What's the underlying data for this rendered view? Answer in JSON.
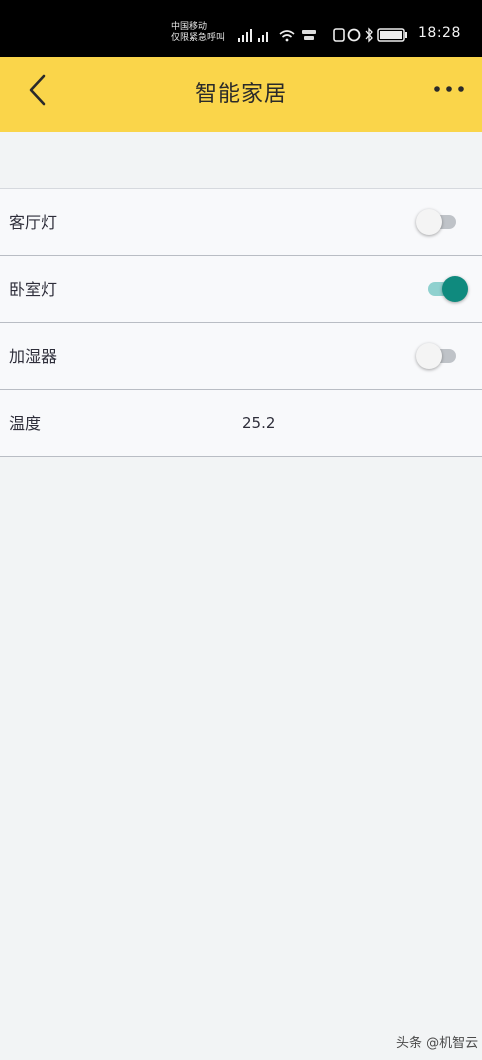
{
  "status_bar": {
    "carrier_line1": "中国移动",
    "carrier_line2": "仅限紧急呼叫",
    "time": "18:28",
    "icons": [
      "signal-icon",
      "wifi-icon",
      "nfc-icon",
      "alarm-icon",
      "bluetooth-icon",
      "battery-icon"
    ]
  },
  "header": {
    "title": "智能家居",
    "back_icon": "back-chevron-icon",
    "more_icon": "more-dots-icon",
    "background": "#fad54a"
  },
  "devices": [
    {
      "label": "客厅灯",
      "type": "switch",
      "on": false
    },
    {
      "label": "卧室灯",
      "type": "switch",
      "on": true
    },
    {
      "label": "加湿器",
      "type": "switch",
      "on": false
    },
    {
      "label": "温度",
      "type": "value",
      "value": "25.2"
    }
  ],
  "colors": {
    "toggle_on": "#0f8a7e",
    "toggle_off": "#bfc3c8",
    "page_bg": "#f2f4f5"
  },
  "watermark": "头条 @机智云"
}
